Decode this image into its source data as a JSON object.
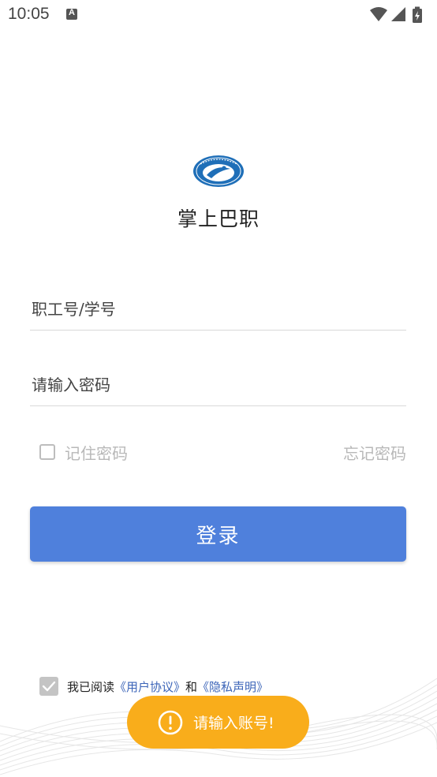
{
  "status_bar": {
    "time": "10:05",
    "notification_icon": "a-icon",
    "icons": [
      "wifi-icon",
      "signal-icon",
      "battery-charging-icon"
    ]
  },
  "app": {
    "logo_icon": "school-logo",
    "title": "掌上巴职"
  },
  "form": {
    "account_placeholder": "职工号/学号",
    "password_placeholder": "请输入密码",
    "remember_label": "记住密码",
    "remember_checked": false,
    "forgot_label": "忘记密码",
    "login_label": "登录"
  },
  "agreement": {
    "checked": true,
    "prefix": "我已阅读",
    "user_agreement": "《用户协议》",
    "conjunction": "和",
    "privacy_statement": "《隐私声明》"
  },
  "toast": {
    "icon": "exclamation-circle-icon",
    "message": "请输入账号!"
  },
  "colors": {
    "primary": "#4f80dc",
    "toast": "#f9ad1b",
    "link": "#3b64b8",
    "muted": "#b8b8b8"
  }
}
